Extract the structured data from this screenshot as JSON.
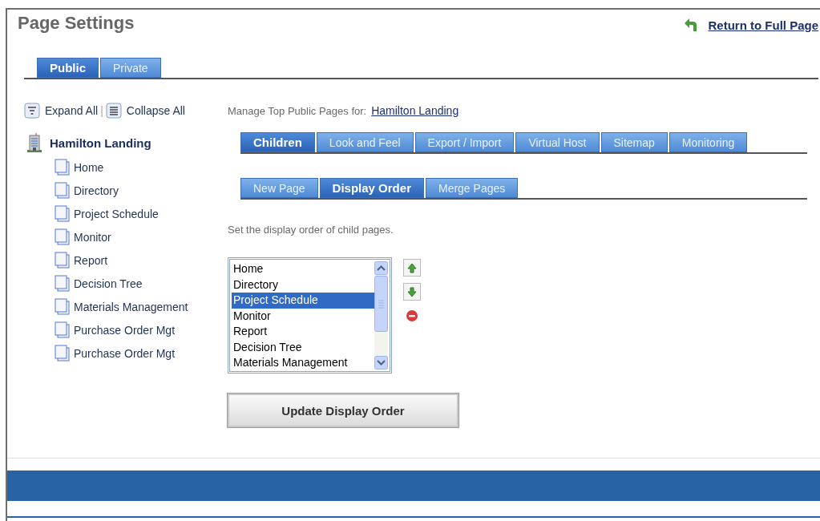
{
  "title": "Page Settings",
  "return_link": "Return to Full Page",
  "scope_tabs": [
    {
      "label": "Public",
      "selected": true
    },
    {
      "label": "Private",
      "selected": false
    }
  ],
  "tree_tools": {
    "expand": "Expand All",
    "separator": "|",
    "collapse": "Collapse All"
  },
  "tree": {
    "label": "Hamilton Landing",
    "children": [
      {
        "label": "Home"
      },
      {
        "label": "Directory"
      },
      {
        "label": "Project Schedule"
      },
      {
        "label": "Monitor"
      },
      {
        "label": "Report"
      },
      {
        "label": "Decision Tree"
      },
      {
        "label": "Materials Management"
      },
      {
        "label": "Purchase Order Mgt"
      },
      {
        "label": "Purchase Order Mgt"
      }
    ]
  },
  "manage": {
    "label": "Manage Top Public Pages for:",
    "link": "Hamilton Landing"
  },
  "main_tabs": [
    {
      "label": "Children",
      "selected": true
    },
    {
      "label": "Look and Feel",
      "selected": false
    },
    {
      "label": "Export / Import",
      "selected": false
    },
    {
      "label": "Virtual Host",
      "selected": false
    },
    {
      "label": "Sitemap",
      "selected": false
    },
    {
      "label": "Monitoring",
      "selected": false
    }
  ],
  "sub_tabs": [
    {
      "label": "New Page",
      "selected": false
    },
    {
      "label": "Display Order",
      "selected": true
    },
    {
      "label": "Merge Pages",
      "selected": false
    }
  ],
  "instruction": "Set the display order of child pages.",
  "order_list": [
    {
      "label": "Home",
      "selected": false
    },
    {
      "label": "Directory",
      "selected": false
    },
    {
      "label": "Project Schedule",
      "selected": true
    },
    {
      "label": "Monitor",
      "selected": false
    },
    {
      "label": "Report",
      "selected": false
    },
    {
      "label": "Decision Tree",
      "selected": false
    },
    {
      "label": "Materials Management",
      "selected": false
    }
  ],
  "order_buttons": [
    {
      "kind": "up"
    },
    {
      "kind": "down"
    },
    {
      "kind": "remove"
    }
  ],
  "update_button": "Update Display Order"
}
